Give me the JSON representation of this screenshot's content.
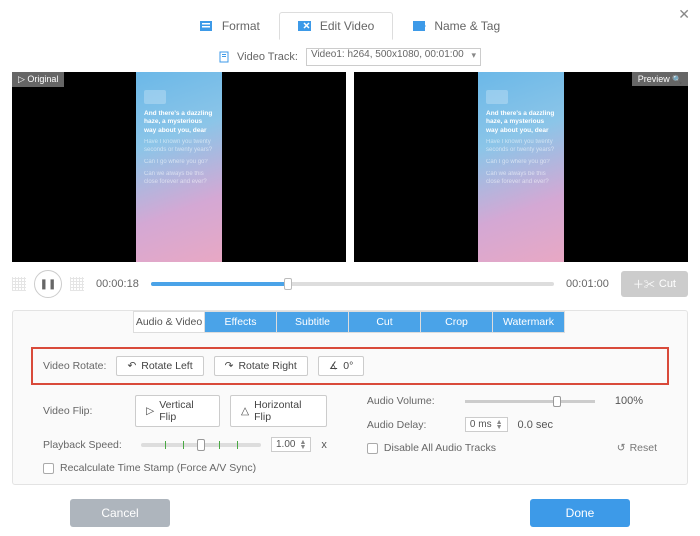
{
  "top_tabs": {
    "format": "Format",
    "edit": "Edit Video",
    "name_tag": "Name & Tag"
  },
  "track": {
    "label": "Video Track:",
    "selected": "Video1: h264, 500x1080, 00:01:00"
  },
  "badges": {
    "original": "▷ Original",
    "preview": "Preview"
  },
  "phone_lyrics": {
    "bold": "And there's a dazzling haze, a mysterious way about you, dear",
    "l1": "Have I known you twenty seconds or twenty years?",
    "l2": "Can I go where you go?",
    "l3": "Can we always be this close forever and ever?"
  },
  "playback": {
    "current": "00:00:18",
    "total": "00:01:00",
    "cut": "Cut"
  },
  "sub_tabs": [
    "Audio & Video",
    "Effects",
    "Subtitle",
    "Cut",
    "Crop",
    "Watermark"
  ],
  "rotate": {
    "label": "Video Rotate:",
    "left": "Rotate Left",
    "right": "Rotate Right",
    "angle": "0°"
  },
  "flip": {
    "label": "Video Flip:",
    "vertical": "Vertical Flip",
    "horizontal": "Horizontal Flip"
  },
  "speed": {
    "label": "Playback Speed:",
    "value": "1.00",
    "suffix": "x"
  },
  "volume": {
    "label": "Audio Volume:",
    "value": "100%"
  },
  "delay": {
    "label": "Audio Delay:",
    "value": "0 ms",
    "suffix": "0.0 sec"
  },
  "checks": {
    "recalc": "Recalculate Time Stamp (Force A/V Sync)",
    "disable_audio": "Disable All Audio Tracks"
  },
  "reset": "Reset",
  "footer": {
    "cancel": "Cancel",
    "done": "Done"
  }
}
